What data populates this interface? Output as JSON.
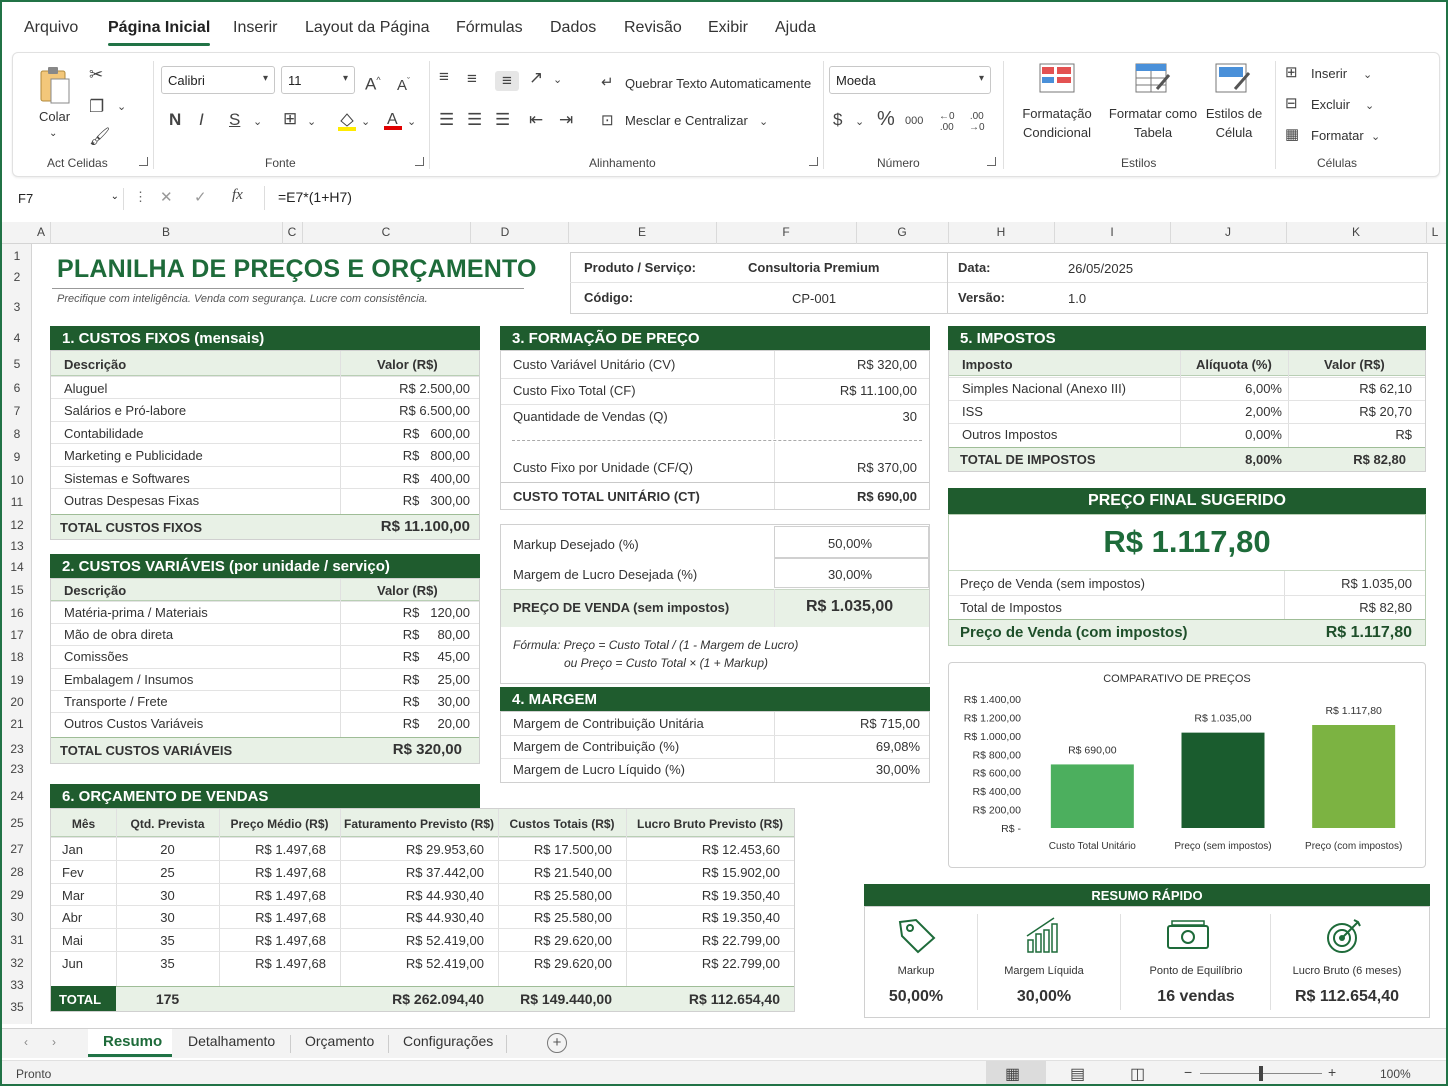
{
  "menu": {
    "tabs": [
      "Arquivo",
      "Página Inicial",
      "Inserir",
      "Layout da Página",
      "Fórmulas",
      "Dados",
      "Revisão",
      "Exibir",
      "Ajuda"
    ]
  },
  "ribbon": {
    "clipboard": {
      "paste": "Colar",
      "group": "Act Celidas"
    },
    "font": {
      "name": "Calibri",
      "size": "11",
      "bold": "N",
      "italic": "I",
      "underline": "S",
      "group": "Fonte"
    },
    "alignment": {
      "wrap": "Quebrar Texto Automaticamente",
      "merge": "Mesclar e Centralizar",
      "group": "Alinhamento"
    },
    "number": {
      "format": "Moeda",
      "currency": "$",
      "percent": "%",
      "thousands": "000",
      "group": "Número"
    },
    "styles": {
      "conditional": "Formatação Condicional",
      "table": "Formatar como Tabela",
      "cell": "Estilos de Célula",
      "group": "Estilos"
    },
    "cells": {
      "insert": "Inserir",
      "delete": "Excluir",
      "format": "Formatar",
      "group": "Células"
    }
  },
  "formula_bar": {
    "cell": "F7",
    "fx": "fx",
    "formula": "=E7*(1+H7)"
  },
  "columns": [
    "A",
    "B",
    "C",
    "C",
    "D",
    "E",
    "F",
    "G",
    "H",
    "I",
    "J",
    "K",
    "L"
  ],
  "rows": [
    "1",
    "2",
    "3",
    "4",
    "5",
    "6",
    "7",
    "8",
    "9",
    "10",
    "11",
    "12",
    "13",
    "14",
    "15",
    "16",
    "17",
    "18",
    "19",
    "20",
    "21",
    "23",
    "23",
    "24",
    "25",
    "27",
    "28",
    "29",
    "30",
    "31",
    "32",
    "33",
    "35"
  ],
  "sheet": {
    "title": "PLANILHA DE PREÇOS E ORÇAMENTO",
    "subtitle": "Precifique com inteligência. Venda com segurança. Lucre com consistência.",
    "info": {
      "produto_label": "Produto / Serviço:",
      "produto": "Consultoria Premium",
      "codigo_label": "Código:",
      "codigo": "CP-001",
      "data_label": "Data:",
      "data": "26/05/2025",
      "versao_label": "Versão:",
      "versao": "1.0"
    },
    "fixos": {
      "title": "1. CUSTOS FIXOS (mensais)",
      "h1": "Descrição",
      "h2": "Valor (R$)",
      "rows": [
        [
          "Aluguel",
          "R$ 2.500,00"
        ],
        [
          "Salários e Pró-labore",
          "R$ 6.500,00"
        ],
        [
          "Contabilidade",
          "R$   600,00"
        ],
        [
          "Marketing e Publicidade",
          "R$   800,00"
        ],
        [
          "Sistemas e Softwares",
          "R$   400,00"
        ],
        [
          "Outras Despesas Fixas",
          "R$   300,00"
        ]
      ],
      "total_label": "TOTAL CUSTOS FIXOS",
      "total": "R$ 11.100,00"
    },
    "variaveis": {
      "title": "2. CUSTOS VARIÁVEIS (por unidade / serviço)",
      "h1": "Descrição",
      "h2": "Valor (R$)",
      "rows": [
        [
          "Matéria-prima / Materiais",
          "R$   120,00"
        ],
        [
          "Mão de obra direta",
          "R$     80,00"
        ],
        [
          "Comissões",
          "R$     45,00"
        ],
        [
          "Embalagem / Insumos",
          "R$     25,00"
        ],
        [
          "Transporte / Frete",
          "R$     30,00"
        ],
        [
          "Outros Custos Variáveis",
          "R$     20,00"
        ]
      ],
      "total_label": "TOTAL CUSTOS VARIÁVEIS",
      "total": "R$ 320,00"
    },
    "formacao": {
      "title": "3. FORMAÇÃO DE PREÇO",
      "rows": [
        [
          "Custo Variável Unitário (CV)",
          "R$ 320,00"
        ],
        [
          "Custo Fixo Total (CF)",
          "R$ 11.100,00"
        ],
        [
          "Quantidade de Vendas (Q)",
          "30"
        ]
      ],
      "cfq": [
        "Custo Fixo por Unidade (CF/Q)",
        "R$ 370,00"
      ],
      "ct": [
        "CUSTO TOTAL UNITÁRIO (CT)",
        "R$ 690,00"
      ],
      "markup": [
        "Markup Desejado (%)",
        "50,00%"
      ],
      "margem": [
        "Margem de Lucro Desejada (%)",
        "30,00%"
      ],
      "preco": [
        "PREÇO DE VENDA (sem impostos)",
        "R$ 1.035,00"
      ],
      "formula1": "Fórmula: Preço = Custo Total / (1 - Margem de Lucro)",
      "formula2": "ou Preço = Custo Total × (1 + Markup)"
    },
    "margem": {
      "title": "4. MARGEM",
      "rows": [
        [
          "Margem de Contribuição Unitária",
          "R$ 715,00"
        ],
        [
          "Margem de Contribuição (%)",
          "69,08%"
        ],
        [
          "Margem de Lucro Líquido (%)",
          "30,00%"
        ]
      ]
    },
    "impostos": {
      "title": "5. IMPOSTOS",
      "h1": "Imposto",
      "h2": "Alíquota (%)",
      "h3": "Valor (R$)",
      "rows": [
        [
          "Simples Nacional (Anexo III)",
          "6,00%",
          "R$ 62,10"
        ],
        [
          "ISS",
          "2,00%",
          "R$ 20,70"
        ],
        [
          "Outros Impostos",
          "0,00%",
          "R$"
        ]
      ],
      "total": [
        "TOTAL DE IMPOSTOS",
        "8,00%",
        "R$ 82,80"
      ]
    },
    "final": {
      "title": "PREÇO FINAL SUGERIDO",
      "value": "R$ 1.117,80",
      "rows": [
        [
          "Preço de Venda (sem impostos)",
          "R$ 1.035,00"
        ],
        [
          "Total de Impostos",
          "R$     82,80"
        ]
      ],
      "total": [
        "Preço de Venda (com impostos)",
        "R$ 1.117,80"
      ]
    },
    "orcamento": {
      "title": "6. ORÇAMENTO DE VENDAS",
      "headers": [
        "Mês",
        "Qtd. Prevista",
        "Preço Médio (R$)",
        "Faturamento Previsto (R$)",
        "Custos Totais (R$)",
        "Lucro Bruto Previsto (R$)"
      ],
      "rows": [
        [
          "Jan",
          "20",
          "R$ 1.497,68",
          "R$ 29.953,60",
          "R$ 17.500,00",
          "R$ 12.453,60"
        ],
        [
          "Fev",
          "25",
          "R$ 1.497,68",
          "R$ 37.442,00",
          "R$ 21.540,00",
          "R$ 15.902,00"
        ],
        [
          "Mar",
          "30",
          "R$ 1.497,68",
          "R$ 44.930,40",
          "R$ 25.580,00",
          "R$ 19.350,40"
        ],
        [
          "Abr",
          "30",
          "R$ 1.497,68",
          "R$ 44.930,40",
          "R$ 25.580,00",
          "R$ 19.350,40"
        ],
        [
          "Mai",
          "35",
          "R$ 1.497,68",
          "R$ 52.419,00",
          "R$ 29.620,00",
          "R$ 22.799,00"
        ],
        [
          "Jun",
          "35",
          "R$ 1.497,68",
          "R$ 52.419,00",
          "R$ 29.620,00",
          "R$ 22.799,00"
        ]
      ],
      "total": [
        "TOTAL",
        "175",
        "",
        "R$ 262.094,40",
        "R$ 149.440,00",
        "R$ 112.654,40"
      ]
    },
    "resumo": {
      "title": "RESUMO RÁPIDO",
      "items": [
        [
          "Markup",
          "50,00%"
        ],
        [
          "Margem Líquida",
          "30,00%"
        ],
        [
          "Ponto de Equilíbrio",
          "16 vendas"
        ],
        [
          "Lucro Bruto (6 meses)",
          "R$ 112.654,40"
        ]
      ]
    }
  },
  "chart_data": {
    "type": "bar",
    "title": "COMPARATIVO DE PREÇOS",
    "categories": [
      "Custo Total Unitário",
      "Preço (sem impostos)",
      "Preço (com impostos)"
    ],
    "values": [
      690,
      1035,
      1117.8
    ],
    "data_labels": [
      "R$ 690,00",
      "R$ 1.035,00",
      "R$ 1.117,80"
    ],
    "y_ticks": [
      "R$ -",
      "R$ 200,00",
      "R$ 400,00",
      "R$ 600,00",
      "R$ 800,00",
      "R$ 1.000,00",
      "R$ 1.200,00",
      "R$ 1.400,00"
    ],
    "ylim": [
      0,
      1400
    ],
    "colors": [
      "#4caf5e",
      "#1a5c2e",
      "#7cb342"
    ]
  },
  "sheet_tabs": [
    "Resumo",
    "Detalhamento",
    "Orçamento",
    "Configurações"
  ],
  "status": {
    "ready": "Pronto",
    "zoom": "100%"
  }
}
